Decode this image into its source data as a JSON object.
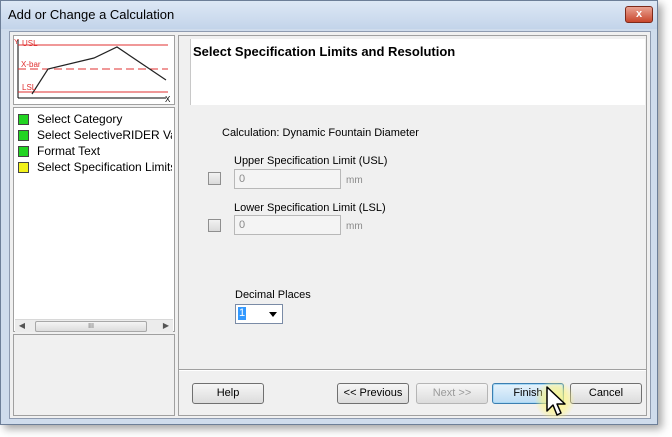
{
  "window": {
    "title": "Add or Change a Calculation",
    "close_label": "x"
  },
  "preview_chart": {
    "y_label": "Y",
    "x_label": "X",
    "usl_label": "USL",
    "xbar_label": "X-bar",
    "lsl_label": "LSL",
    "limit_color": "#e03030",
    "line_color": "#222222"
  },
  "steps": [
    {
      "label": "Select Category",
      "color": "#22d422"
    },
    {
      "label": "Select SelectiveRIDER Va...",
      "color": "#22d422"
    },
    {
      "label": "Format Text",
      "color": "#22d422"
    },
    {
      "label": "Select Specification Limits",
      "color": "#f2f21a"
    }
  ],
  "scrollbar": {
    "thumb_grip": "III"
  },
  "header": {
    "title": "Select Specification Limits and Resolution"
  },
  "calculation": {
    "label": "Calculation: Dynamic Fountain Diameter"
  },
  "usl": {
    "label": "Upper Specification Limit (USL)",
    "value": "0",
    "unit": "mm"
  },
  "lsl": {
    "label": "Lower Specification Limit (LSL)",
    "value": "0",
    "unit": "mm"
  },
  "decimal": {
    "label": "Decimal Places",
    "value": "1"
  },
  "buttons": {
    "help": "Help",
    "previous": "<< Previous",
    "next": "Next >>",
    "finish": "Finish",
    "cancel": "Cancel"
  }
}
